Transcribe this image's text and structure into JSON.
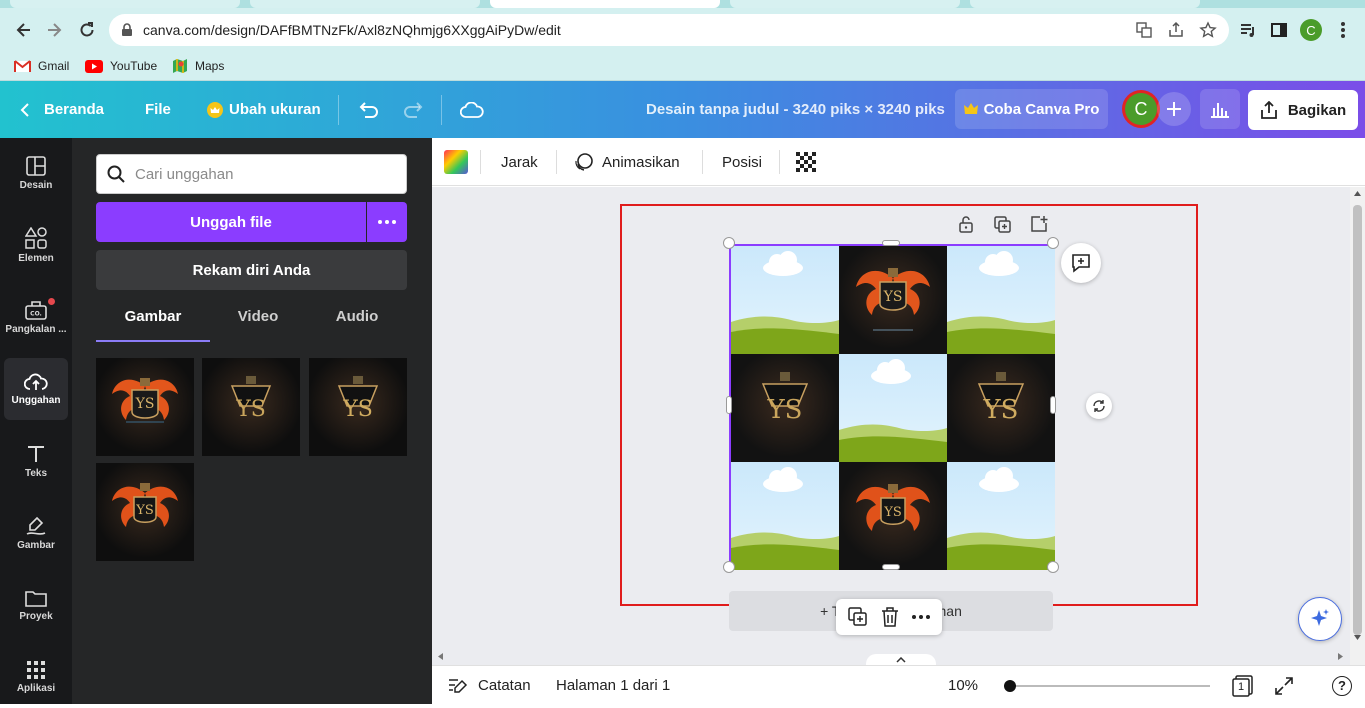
{
  "browser": {
    "url": "canva.com/design/DAFfBMTNzFk/Axl8zNQhmjg6XXggAiPyDw/edit",
    "bookmarks": [
      {
        "label": "Gmail",
        "icon": "gmail-icon"
      },
      {
        "label": "YouTube",
        "icon": "youtube-icon"
      },
      {
        "label": "Maps",
        "icon": "maps-icon"
      }
    ],
    "profile_initial": "C"
  },
  "header": {
    "back_label": "Beranda",
    "file_label": "File",
    "resize_label": "Ubah ukuran",
    "doc_title": "Desain tanpa judul - 3240 piks × 3240 piks",
    "pro_label": "Coba Canva Pro",
    "avatar_initial": "C",
    "share_label": "Bagikan"
  },
  "rail": {
    "items": [
      {
        "label": "Desain",
        "icon": "layout-icon"
      },
      {
        "label": "Elemen",
        "icon": "shapes-icon"
      },
      {
        "label": "Pangkalan ...",
        "icon": "brand-kit-icon"
      },
      {
        "label": "Unggahan",
        "icon": "cloud-upload-icon"
      },
      {
        "label": "Teks",
        "icon": "text-icon"
      },
      {
        "label": "Gambar",
        "icon": "draw-icon"
      },
      {
        "label": "Proyek",
        "icon": "folder-icon"
      },
      {
        "label": "Aplikasi",
        "icon": "apps-icon"
      }
    ]
  },
  "panel": {
    "search_placeholder": "Cari unggahan",
    "upload_label": "Unggah file",
    "record_label": "Rekam diri Anda",
    "tabs": [
      "Gambar",
      "Video",
      "Audio"
    ],
    "active_tab": "Gambar"
  },
  "context_toolbar": {
    "spacing_label": "Jarak",
    "animate_label": "Animasikan",
    "position_label": "Posisi"
  },
  "canvas": {
    "add_page_label": "+ Tambahkan halaman"
  },
  "footer": {
    "notes_label": "Catatan",
    "page_label": "Halaman 1 dari 1",
    "zoom": "10%",
    "page_count": "1",
    "help": "?"
  },
  "colors": {
    "accent": "#8b3dff",
    "frame_red": "#e01c1c",
    "grass": "#7ea61a"
  }
}
